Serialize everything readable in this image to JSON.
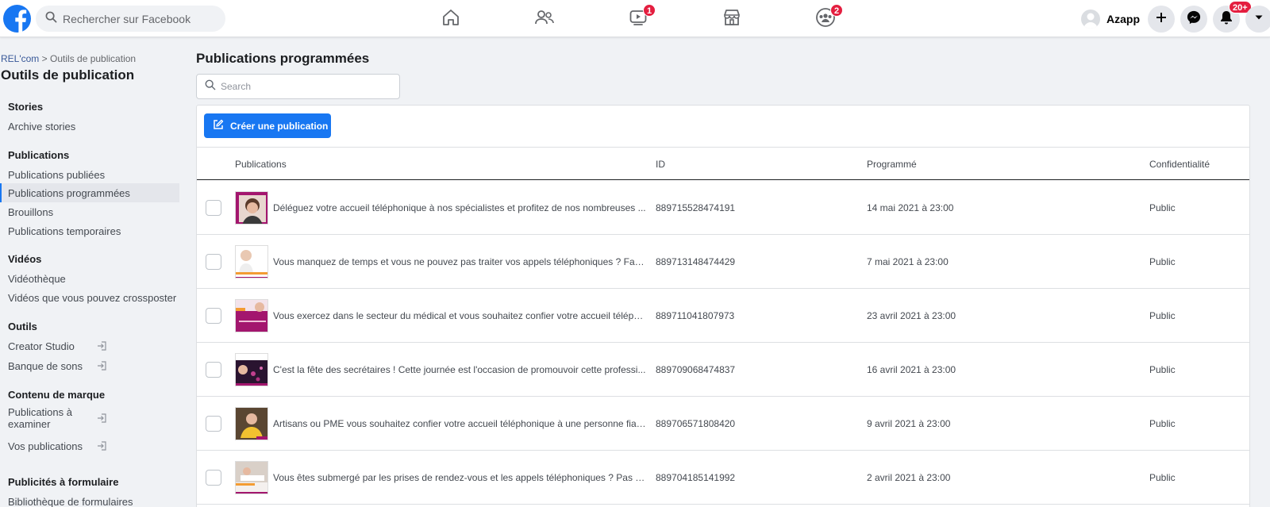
{
  "topbar": {
    "search_placeholder": "Rechercher sur Facebook",
    "watch_badge": "1",
    "groups_badge": "2",
    "profile_name": "Azapp",
    "notifications_badge": "20+"
  },
  "colors": {
    "accent": "#1877f2",
    "badge": "#e41e3f",
    "thumb_magenta": "#a3166e"
  },
  "sidebar": {
    "breadcrumb_parent": "REL'com",
    "breadcrumb_sep": ">",
    "breadcrumb_current": "Outils de publication",
    "title": "Outils de publication",
    "sections": {
      "stories": "Stories",
      "publications": "Publications",
      "videos": "Vidéos",
      "outils": "Outils",
      "contenu_marque": "Contenu de marque",
      "publicites_formulaire": "Publicités à formulaire"
    },
    "items": {
      "archive_stories": "Archive stories",
      "publications_publiees": "Publications publiées",
      "publications_programmees": "Publications programmées",
      "brouillons": "Brouillons",
      "publications_temporaires": "Publications temporaires",
      "videotheque": "Vidéothèque",
      "videos_crossposter": "Vidéos que vous pouvez crossposter",
      "creator_studio": "Creator Studio",
      "banque_sons": "Banque de sons",
      "publications_examiner": "Publications à examiner",
      "vos_publications": "Vos publications",
      "bibliotheque_formulaires": "Bibliothèque de formulaires"
    }
  },
  "main": {
    "title": "Publications programmées",
    "search_placeholder": "Search",
    "create_button": "Créer une publication",
    "columns": {
      "publications": "Publications",
      "id": "ID",
      "programme": "Programmé",
      "confidentialite": "Confidentialité"
    },
    "rows": [
      {
        "text": "Déléguez votre accueil téléphonique à nos spécialistes et profitez de nos nombreuses ...",
        "id": "889715528474191",
        "scheduled": "14 mai 2021 à 23:00",
        "privacy": "Public"
      },
      {
        "text": "Vous manquez de temps et vous ne pouvez pas traiter vos appels téléphoniques ? Fait...",
        "id": "889713148474429",
        "scheduled": "7 mai 2021 à 23:00",
        "privacy": "Public"
      },
      {
        "text": "Vous exercez dans le secteur du médical et vous souhaitez confier votre accueil téléph...",
        "id": "889711041807973",
        "scheduled": "23 avril 2021 à 23:00",
        "privacy": "Public"
      },
      {
        "text": "C'est la fête des secrétaires ! Cette journée est l'occasion de promouvoir cette professi...",
        "id": "889709068474837",
        "scheduled": "16 avril 2021 à 23:00",
        "privacy": "Public"
      },
      {
        "text": "Artisans ou PME vous souhaitez confier votre accueil téléphonique à une personne fiab...",
        "id": "889706571808420",
        "scheduled": "9 avril 2021 à 23:00",
        "privacy": "Public"
      },
      {
        "text": "Vous êtes submergé par les prises de rendez-vous et les appels téléphoniques ? Pas de...",
        "id": "889704185141992",
        "scheduled": "2 avril 2021 à 23:00",
        "privacy": "Public"
      }
    ]
  }
}
